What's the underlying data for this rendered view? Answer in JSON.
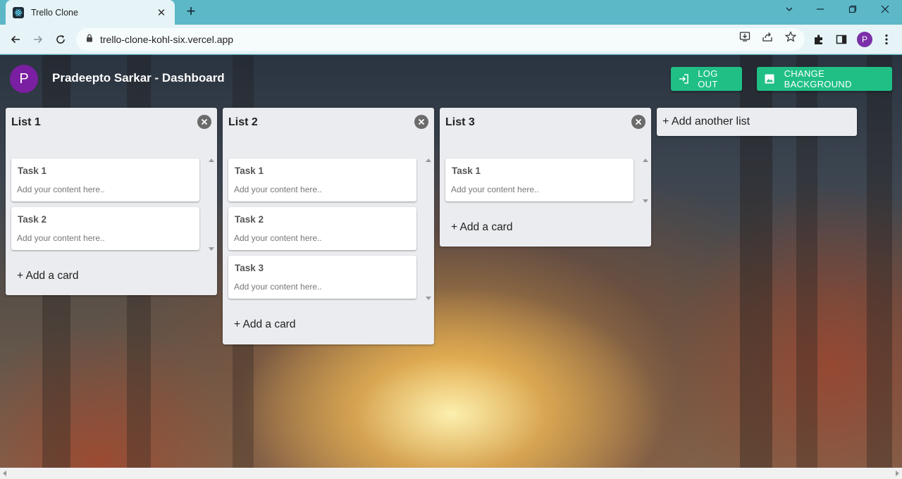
{
  "browser": {
    "tab_title": "Trello Clone",
    "tab_close": "✕",
    "new_tab": "+",
    "url": "trello-clone-kohl-six.vercel.app",
    "profile_initial": "P"
  },
  "header": {
    "avatar_initial": "P",
    "title": "Pradeepto Sarkar - Dashboard",
    "logout_label": "LOG OUT",
    "change_bg_label": "CHANGE BACKGROUND"
  },
  "lists": [
    {
      "title": "List 1",
      "cards": [
        {
          "title": "Task 1",
          "content": "Add your content here.."
        },
        {
          "title": "Task 2",
          "content": "Add your content here.."
        }
      ],
      "add_card": "+ Add a card"
    },
    {
      "title": "List 2",
      "cards": [
        {
          "title": "Task 1",
          "content": "Add your content here.."
        },
        {
          "title": "Task 2",
          "content": "Add your content here.."
        },
        {
          "title": "Task 3",
          "content": "Add your content here.."
        }
      ],
      "add_card": "+ Add a card"
    },
    {
      "title": "List 3",
      "cards": [
        {
          "title": "Task 1",
          "content": "Add your content here.."
        }
      ],
      "add_card": "+ Add a card"
    }
  ],
  "add_list": "+ Add another list",
  "colors": {
    "button": "#1fbf85",
    "avatar": "#7b1fa2",
    "list_bg": "#ebecf0"
  }
}
